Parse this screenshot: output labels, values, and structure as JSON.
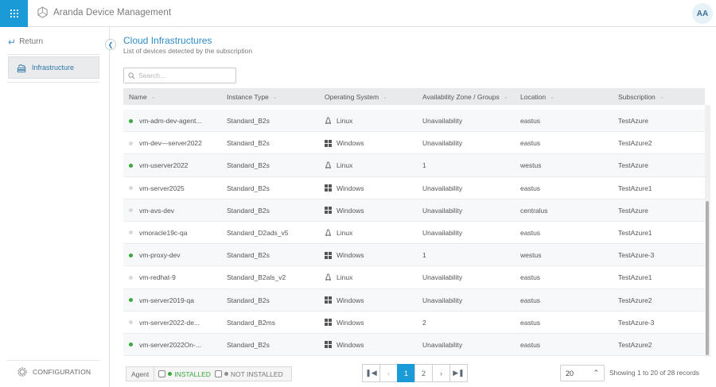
{
  "app": {
    "title": "Aranda Device Management",
    "user_initials": "AA"
  },
  "sidebar": {
    "return_label": "Return",
    "items": [
      {
        "label": "Infrastructure",
        "icon": "cloud-server-icon",
        "active": true
      }
    ],
    "config_label": "CONFIGURATION"
  },
  "page": {
    "title": "Cloud Infrastructures",
    "subtitle": "List of devices detected by the subscription",
    "search_placeholder": "Search..."
  },
  "table": {
    "columns": [
      "Name",
      "Instance Type",
      "Operating System",
      "Availability Zone / Groups",
      "Location",
      "Subscription"
    ],
    "rows": [
      {
        "installed": true,
        "name": "vm-adm-dev-agent...",
        "instance": "Standard_B2s",
        "os": "Linux",
        "zone": "Unavailability",
        "location": "eastus",
        "subscription": "TestAzure"
      },
      {
        "installed": false,
        "name": "vm-dev—server2022",
        "instance": "Standard_B2s",
        "os": "Windows",
        "zone": "Unavailability",
        "location": "eastus",
        "subscription": "TestAzure2"
      },
      {
        "installed": true,
        "name": "vm-userver2022",
        "instance": "Standard_B2s",
        "os": "Linux",
        "zone": "1",
        "location": "westus",
        "subscription": "TestAzure"
      },
      {
        "installed": false,
        "name": "vm-server2025",
        "instance": "Standard_B2s",
        "os": "Windows",
        "zone": "Unavailability",
        "location": "eastus",
        "subscription": "TestAzure1"
      },
      {
        "installed": false,
        "name": "vm-avs-dev",
        "instance": "Standard_B2s",
        "os": "Windows",
        "zone": "Unavailability",
        "location": "centralus",
        "subscription": "TestAzure"
      },
      {
        "installed": false,
        "name": "vmoracle19c-qa",
        "instance": "Standard_D2ads_v5",
        "os": "Linux",
        "zone": "Unavailability",
        "location": "eastus",
        "subscription": "TestAzure1"
      },
      {
        "installed": true,
        "name": "vm-proxy-dev",
        "instance": "Standard_B2s",
        "os": "Windows",
        "zone": "1",
        "location": "westus",
        "subscription": "TestAzure-3"
      },
      {
        "installed": false,
        "name": "vm-redhat-9",
        "instance": "Standard_B2als_v2",
        "os": "Linux",
        "zone": "Unavailability",
        "location": "eastus",
        "subscription": "TestAzure1"
      },
      {
        "installed": true,
        "name": "vm-server2019-qa",
        "instance": "Standard_B2s",
        "os": "Windows",
        "zone": "Unavailability",
        "location": "eastus",
        "subscription": "TestAzure2"
      },
      {
        "installed": false,
        "name": "vm-server2022-de...",
        "instance": "Standard_B2ms",
        "os": "Windows",
        "zone": "2",
        "location": "eastus",
        "subscription": "TestAzure-3"
      },
      {
        "installed": true,
        "name": "vm-server2022On-...",
        "instance": "Standard_B2s",
        "os": "Windows",
        "zone": "Unavailability",
        "location": "eastus",
        "subscription": "TestAzure2"
      }
    ]
  },
  "footer": {
    "agent_label": "Agent",
    "installed_label": "INSTALLED",
    "not_installed_label": "NOT INSTALLED",
    "pages": [
      "1",
      "2"
    ],
    "current_page": "1",
    "page_size": "20",
    "records_text": "Showing 1 to 20 of 28 records"
  },
  "colors": {
    "accent": "#1a9ad6",
    "installed": "#39a83f",
    "not_installed": "#d9d9d9"
  }
}
